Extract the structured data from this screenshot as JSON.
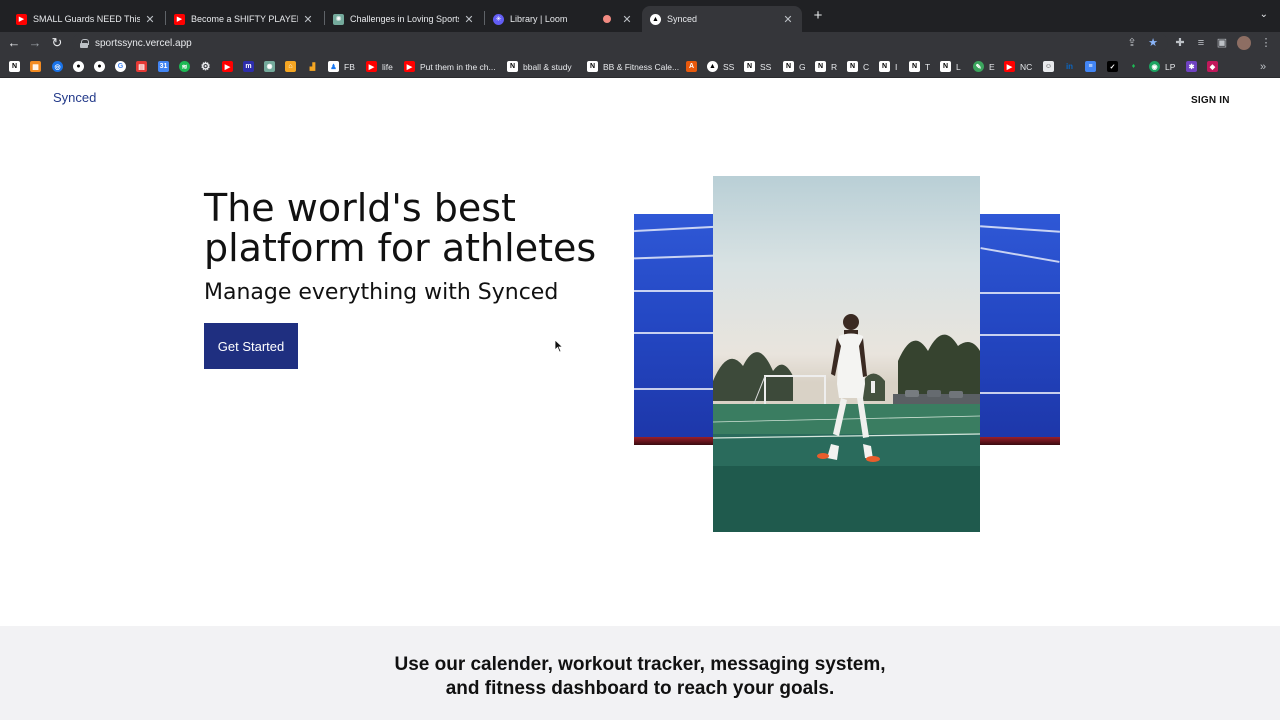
{
  "browser": {
    "tabs": [
      {
        "title": "SMALL Guards NEED This Foot",
        "favicon": "youtube-icon",
        "color": "#ff0000"
      },
      {
        "title": "Become a SHIFTY PLAYER! Put",
        "favicon": "youtube-icon",
        "color": "#ff0000"
      },
      {
        "title": "Challenges in Loving Sports",
        "favicon": "chatgpt-icon",
        "color": "#74aa9c"
      },
      {
        "title": "Library | Loom",
        "favicon": "loom-icon",
        "color": "#625df5"
      },
      {
        "title": "Synced",
        "favicon": "synced-icon",
        "color": "#ffffff"
      }
    ],
    "url": "sportssync.vercel.app",
    "bookmarks": [
      {
        "label": "FB",
        "color": "#1877f2"
      },
      {
        "label": "life",
        "color": "#ff0000"
      },
      {
        "label": "Put them in the ch...",
        "color": "#ff0000"
      },
      {
        "label": "bball & study",
        "color": "#ffffff"
      },
      {
        "label": "BB & Fitness Cale...",
        "color": "#ffffff"
      },
      {
        "label": "SS",
        "color": "#000000"
      },
      {
        "label": "SS",
        "color": "#ffffff"
      },
      {
        "label": "G",
        "color": "#ffffff"
      },
      {
        "label": "R",
        "color": "#ffffff"
      },
      {
        "label": "C",
        "color": "#ffffff"
      },
      {
        "label": "I",
        "color": "#ffffff"
      },
      {
        "label": "T",
        "color": "#ffffff"
      },
      {
        "label": "L",
        "color": "#ffffff"
      },
      {
        "label": "E",
        "color": "#3ba55d"
      },
      {
        "label": "NC",
        "color": "#ff0000"
      },
      {
        "label": "LP",
        "color": "#1da462"
      }
    ]
  },
  "page": {
    "brand": "Synced",
    "signin": "SIGN IN",
    "hero_title": "The world's best platform for athletes",
    "hero_subtitle": "Manage everything with Synced",
    "cta": "Get Started",
    "band_text_line1": "Use our calender, workout tracker, messaging system,",
    "band_text_line2": "and fitness dashboard to reach your goals.",
    "accent": "#1f2f80"
  }
}
